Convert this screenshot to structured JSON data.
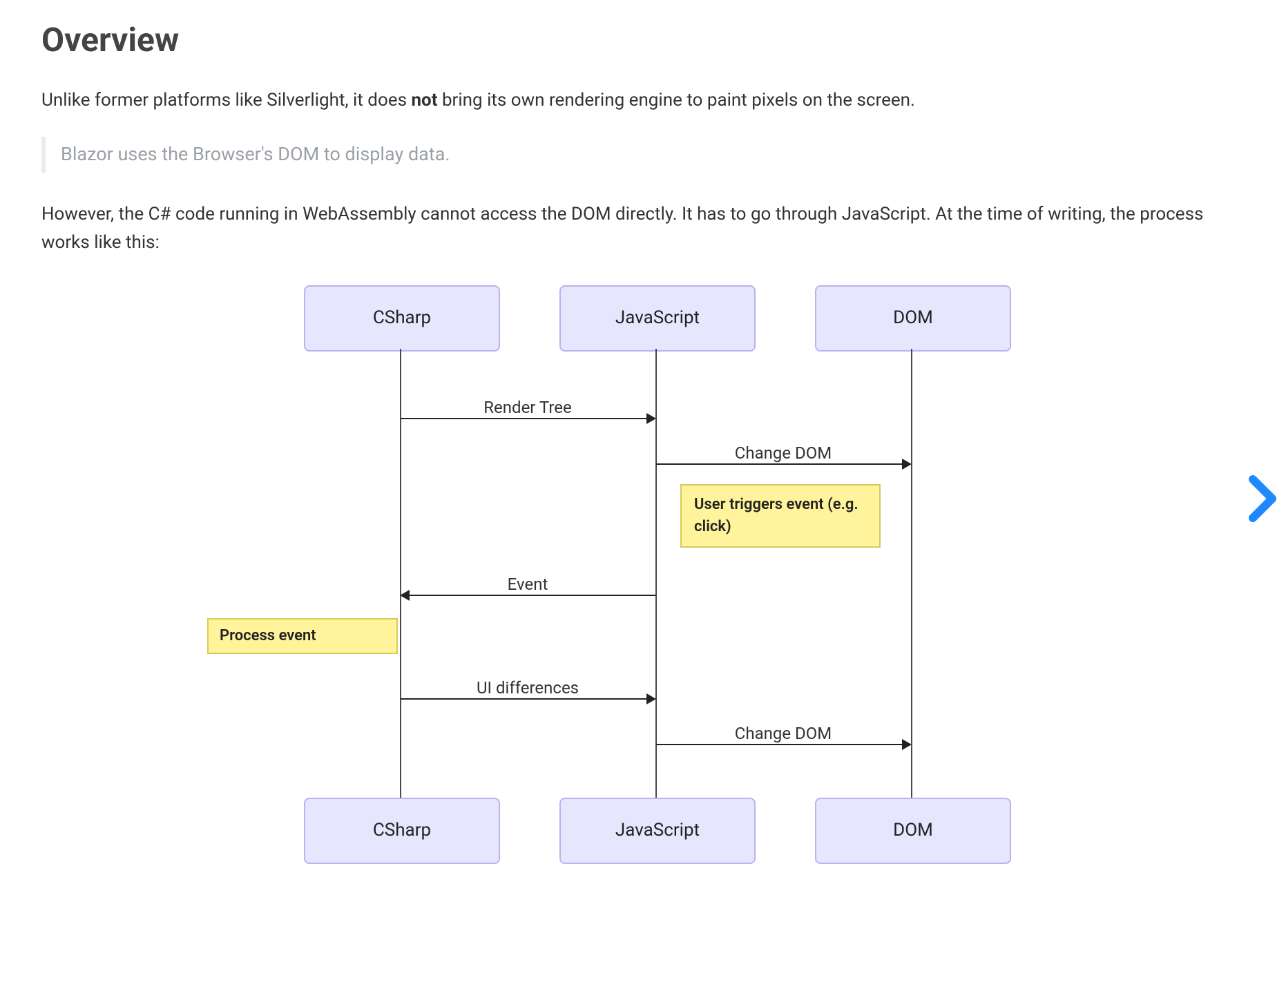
{
  "heading": "Overview",
  "para1_pre": "Unlike former platforms like Silverlight, it does ",
  "para1_bold": "not",
  "para1_post": " bring its own rendering engine to paint pixels on the screen.",
  "callout": "Blazor uses the Browser's DOM to display data.",
  "para2": "However, the C# code running in WebAssembly cannot access the DOM directly. It has to go through JavaScript. At the time of writing, the process works like this:",
  "diagram": {
    "actors": {
      "csharp": "CSharp",
      "javascript": "JavaScript",
      "dom": "DOM"
    },
    "messages": {
      "render_tree": "Render Tree",
      "change_dom_1": "Change DOM",
      "event": "Event",
      "ui_diff": "UI differences",
      "change_dom_2": "Change DOM"
    },
    "notes": {
      "trigger": "User triggers event (e.g. click)",
      "process": "Process event"
    }
  }
}
